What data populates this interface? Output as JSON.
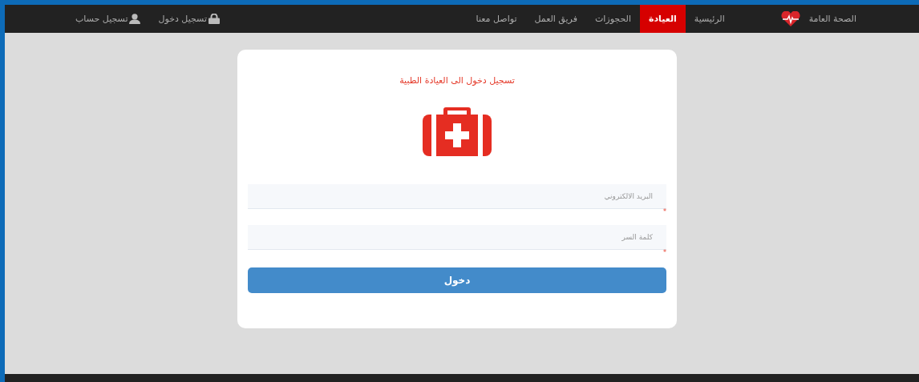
{
  "navbar": {
    "brand": "الصحة العامة",
    "items": [
      {
        "label": "الرئيسية",
        "selected": false
      },
      {
        "label": "العيادة",
        "selected": true
      },
      {
        "label": "الحجوزات",
        "selected": false
      },
      {
        "label": "فريق العمل",
        "selected": false
      },
      {
        "label": "تواصل معنا",
        "selected": false
      }
    ],
    "account_links": [
      {
        "label": "تسجيل دخول",
        "kind": "lock"
      },
      {
        "label": "تسجيل حساب",
        "kind": "user"
      }
    ]
  },
  "login_card": {
    "title": "تسجيل دخول الى العيادة الطبية",
    "fields": [
      {
        "placeholder": "البريد الالكتروني",
        "required_mark": "*"
      },
      {
        "placeholder": "كلمة السر",
        "required_mark": "*"
      }
    ],
    "submit": "دخول"
  }
}
